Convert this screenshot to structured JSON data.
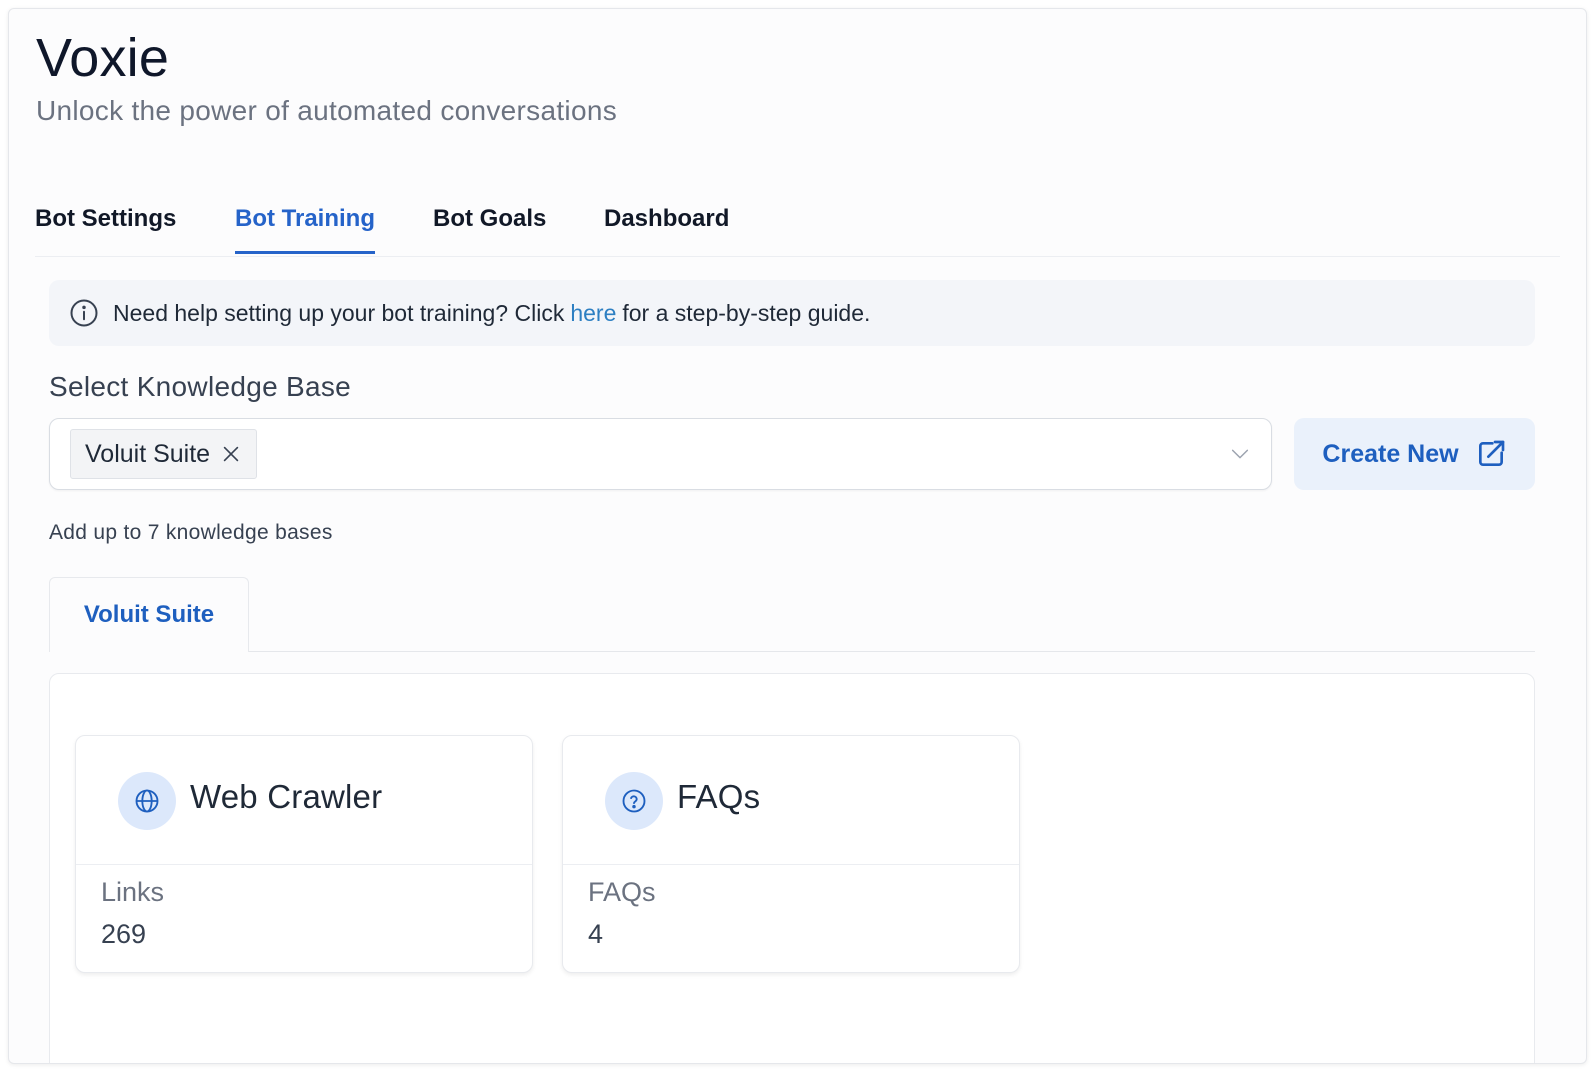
{
  "app": {
    "title": "Voxie",
    "subtitle": "Unlock the power of automated conversations"
  },
  "tabs": [
    {
      "label": "Bot Settings",
      "active": false
    },
    {
      "label": "Bot Training",
      "active": true
    },
    {
      "label": "Bot Goals",
      "active": false
    },
    {
      "label": "Dashboard",
      "active": false
    }
  ],
  "info_banner": {
    "icon": "info-icon",
    "text_before": "Need help setting up your bot training? Click",
    "link_text": "here",
    "text_after": "for a step-by-step guide."
  },
  "knowledge_base": {
    "label": "Select Knowledge Base",
    "selected": [
      {
        "name": "Voluit Suite",
        "remove_icon": "close-icon"
      }
    ],
    "dropdown_icon": "chevron-down-icon",
    "create_button": {
      "label": "Create New",
      "icon": "external-link-icon"
    },
    "hint": "Add up to 7 knowledge bases",
    "tabs": [
      {
        "label": "Voluit Suite",
        "active": true
      }
    ]
  },
  "cards": [
    {
      "title": "Web Crawler",
      "icon": "globe-icon",
      "stat_label": "Links",
      "stat_value": "269"
    },
    {
      "title": "FAQs",
      "icon": "question-circle-icon",
      "stat_label": "FAQs",
      "stat_value": "4"
    }
  ],
  "colors": {
    "accent": "#2563c9",
    "link": "#2d7fc2",
    "icon_bg": "#dce8fb",
    "button_bg": "#eaf1fb"
  }
}
